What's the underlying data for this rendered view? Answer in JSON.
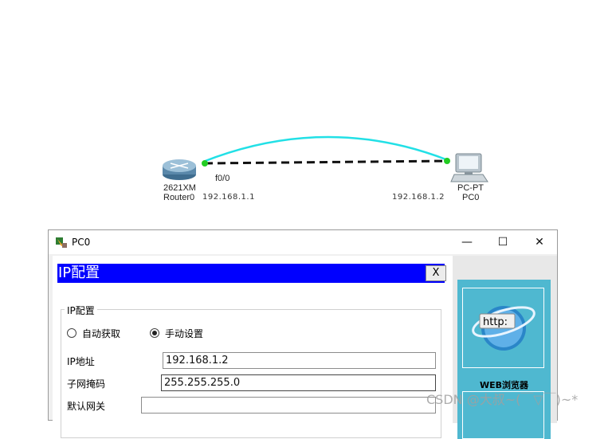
{
  "topology": {
    "router": {
      "model": "2621XM",
      "name": "Router0",
      "ip": "192.168.1.1",
      "port": "f0/0"
    },
    "pc": {
      "model": "PC-PT",
      "name": "PC0",
      "ip": "192.168.1.2"
    }
  },
  "window": {
    "title": "PC0",
    "minimize_glyph": "—",
    "maximize_glyph": "☐",
    "close_glyph": "✕"
  },
  "ip_config": {
    "header_title": "IP配置",
    "close_label": "X",
    "group_title": "IP配置",
    "dhcp_label": "自动获取",
    "static_label": "手动设置",
    "selected_mode": "static",
    "ip_label": "IP地址",
    "ip_value": "192.168.1.2",
    "mask_label": "子网掩码",
    "mask_value": "255.255.255.0",
    "gateway_label": "默认网关",
    "gateway_value": ""
  },
  "apps": {
    "web_label": "WEB浏览器",
    "web_icon_text": "http:"
  },
  "watermark": "CSDN @大叔~(￣▽￣)~*",
  "colors": {
    "header_blue": "#0000ff",
    "tile_cyan": "#4fb8d0",
    "link_cyan": "#22e0e6",
    "link_dash": "#111111",
    "port_green": "#22cc22"
  }
}
